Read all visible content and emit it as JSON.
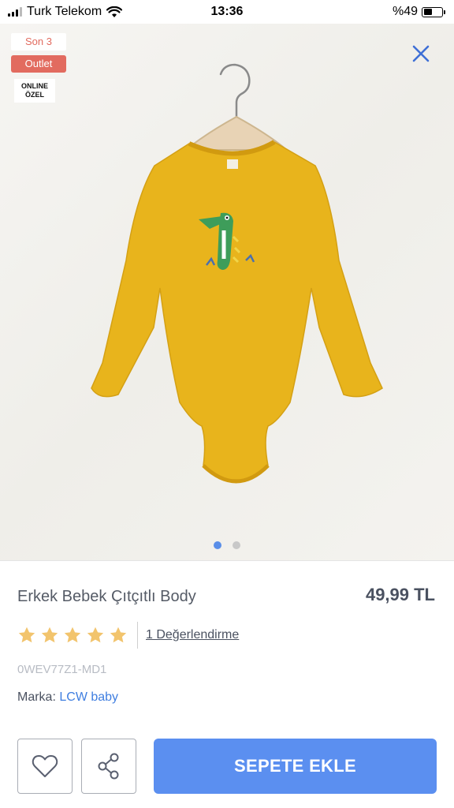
{
  "status_bar": {
    "carrier": "Turk Telekom",
    "time": "13:36",
    "battery": "%49",
    "battery_level": 0.49
  },
  "hero": {
    "badges": {
      "son": "Son 3",
      "outlet": "Outlet",
      "online_line1": "ONLINE",
      "online_line2": "ÖZEL"
    },
    "close_icon": "close-icon",
    "carousel": {
      "count": 2,
      "active_index": 0
    }
  },
  "product": {
    "title": "Erkek Bebek Çıtçıtlı Body",
    "price": "49,99 TL",
    "rating": {
      "stars": 5,
      "label": "1 Değerlendirme"
    },
    "sku": "0WEV77Z1-MD1",
    "brand_label": "Marka:",
    "brand_value": "LCW baby"
  },
  "actions": {
    "favorite_icon": "heart-icon",
    "share_icon": "share-icon",
    "add_to_cart": "SEPETE EKLE"
  },
  "colors": {
    "accent": "#5b8ff0",
    "outlet_badge": "#e26b5f",
    "star": "#f2c46d",
    "product": "#e8b41c"
  }
}
